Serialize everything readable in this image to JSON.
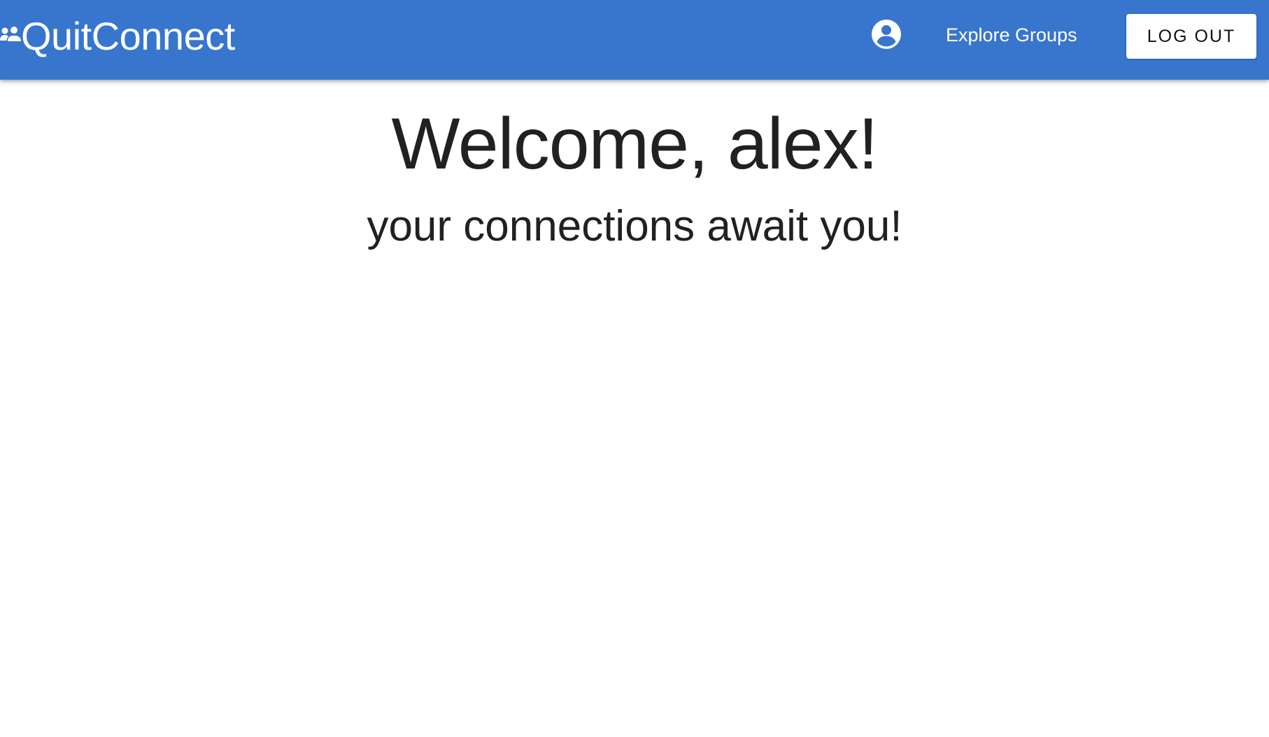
{
  "header": {
    "brand_name": "QuitConnect",
    "brand_icon": "group-icon",
    "profile_icon": "account-circle-icon",
    "nav_link_label": "Explore Groups",
    "logout_label": "LOG OUT",
    "background_color": "#3876cd"
  },
  "main": {
    "title": "Welcome, alex!",
    "subtitle": "your connections await you!"
  }
}
